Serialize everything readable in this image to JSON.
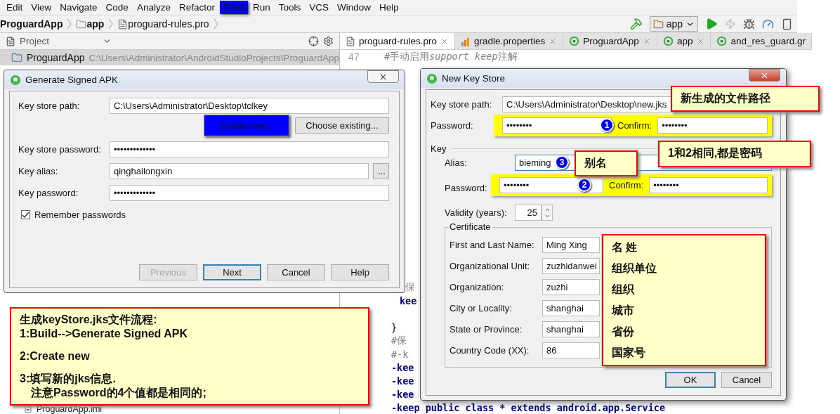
{
  "menu": [
    {
      "label": "Edit",
      "selected": false
    },
    {
      "label": "View",
      "selected": false
    },
    {
      "label": "Navigate",
      "selected": false
    },
    {
      "label": "Code",
      "selected": false
    },
    {
      "label": "Analyze",
      "selected": false
    },
    {
      "label": "Refactor",
      "selected": false
    },
    {
      "label": "Build",
      "selected": true
    },
    {
      "label": "Run",
      "selected": false
    },
    {
      "label": "Tools",
      "selected": false
    },
    {
      "label": "VCS",
      "selected": false
    },
    {
      "label": "Window",
      "selected": false
    },
    {
      "label": "Help",
      "selected": false
    }
  ],
  "breadcrumb": [
    {
      "label": "ProguardApp",
      "kind": "project"
    },
    {
      "label": "app",
      "kind": "module"
    },
    {
      "label": "proguard-rules.pro",
      "kind": "file"
    }
  ],
  "toolbar": {
    "run_config": "app"
  },
  "project_panel": {
    "title": "Project",
    "root": {
      "label": "ProguardApp",
      "path": "C:\\Users\\Administrator\\AndroidStudioProjects\\ProguardApp",
      "selected": true
    },
    "last_item": {
      "label": "ProguardApp.iml"
    }
  },
  "editor_tabs": [
    {
      "label": "proguard-rules.pro",
      "kind": "file",
      "selected": true
    },
    {
      "label": "gradle.properties",
      "kind": "gradle",
      "selected": false
    },
    {
      "label": "ProguardApp",
      "kind": "module",
      "selected": false
    },
    {
      "label": "app",
      "kind": "module",
      "selected": false
    },
    {
      "label": "and_res_guard.gr",
      "kind": "module",
      "selected": false
    }
  ],
  "editor": {
    "first_line": {
      "number": "47",
      "parts": [
        {
          "text": "#手动启用",
          "italic": false
        },
        {
          "text": "support keep",
          "italic": true
        },
        {
          "text": "注解",
          "italic": false
        }
      ]
    },
    "lower_lines": [
      {
        "text": "保",
        "kind": "comment"
      },
      {
        "text": "kee",
        "kind": "keyword"
      },
      {
        "kind": "blank"
      },
      {
        "text": "}",
        "kind": "plain"
      },
      {
        "text": "#保",
        "kind": "comment"
      },
      {
        "text": "#-k",
        "kind": "comment"
      },
      {
        "text": "-kee",
        "kind": "keyword"
      },
      {
        "text": "-kee",
        "kind": "keyword"
      },
      {
        "text": "-kee",
        "kind": "keyword"
      },
      {
        "text": "-keep public class * extends android.app.Service",
        "kind": "keyword"
      }
    ]
  },
  "generate_dialog": {
    "title": "Generate Signed APK",
    "key_store_path": {
      "label": "Key store path:",
      "value": "C:\\Users\\Administrator\\Desktop\\tclkey"
    },
    "path_buttons": [
      {
        "label": "Create new...",
        "highlighted": true
      },
      {
        "label": "Choose existing...",
        "highlighted": false
      }
    ],
    "key_store_password": {
      "label": "Key store password:",
      "value": "•••••••••••••"
    },
    "key_alias": {
      "label": "Key alias:",
      "value": "qinghailongxin",
      "browse": "..."
    },
    "key_password": {
      "label": "Key password:",
      "value": "•••••••••••••"
    },
    "remember": {
      "label": "Remember passwords",
      "checked": true
    },
    "buttons": [
      {
        "label": "Previous",
        "disabled": true,
        "default": false
      },
      {
        "label": "Next",
        "disabled": false,
        "default": true
      },
      {
        "label": "Cancel",
        "disabled": false,
        "default": false
      },
      {
        "label": "Help",
        "disabled": false,
        "default": false
      }
    ]
  },
  "new_key_store": {
    "title": "New Key Store",
    "key_store_path": {
      "label": "Key store path:",
      "value": "C:\\Users\\Administrator\\Desktop\\new.jks"
    },
    "password": {
      "label": "Password:",
      "value": "••••••••",
      "badge": "1",
      "confirm_label": "Confirm:",
      "confirm_value": "••••••••"
    },
    "key_section": "Key",
    "alias": {
      "label": "Alias:",
      "value": "bieming",
      "badge": "3"
    },
    "key_password": {
      "label": "Password:",
      "value": "••••••••",
      "badge": "2",
      "confirm_label": "Confirm:",
      "confirm_value": "••••••••"
    },
    "validity": {
      "label": "Validity (years):",
      "value": "25"
    },
    "certificate": {
      "title": "Certificate",
      "rows": [
        {
          "label": "First and Last Name:",
          "value": "Ming Xing"
        },
        {
          "label": "Organizational Unit:",
          "value": "zuzhidanwei"
        },
        {
          "label": "Organization:",
          "value": "zuzhi"
        },
        {
          "label": "City or Locality:",
          "value": "shanghai"
        },
        {
          "label": "State or Province:",
          "value": "shanghai"
        },
        {
          "label": "Country Code (XX):",
          "value": "86"
        }
      ]
    },
    "buttons": [
      {
        "label": "OK",
        "default": true
      },
      {
        "label": "Cancel",
        "default": false
      }
    ]
  },
  "callouts": {
    "path_note": "新生成的文件路径",
    "password_note": "1和2相同,都是密码",
    "alias_note": "别名",
    "certificate_notes": [
      "名 姓",
      "组织单位",
      "组织",
      "城市",
      "省份",
      "国家号"
    ],
    "steps": [
      {
        "text": "生成keyStore.jks文件流程:",
        "kind": "head"
      },
      {
        "text": "1:Build-->Generate Signed APK",
        "kind": "line"
      },
      {
        "text": "2:Create new",
        "kind": "step"
      },
      {
        "text": "3:填写新的jks信息.",
        "kind": "step"
      },
      {
        "text": "注意Password的4个值都是相同的;",
        "kind": "note"
      }
    ]
  }
}
